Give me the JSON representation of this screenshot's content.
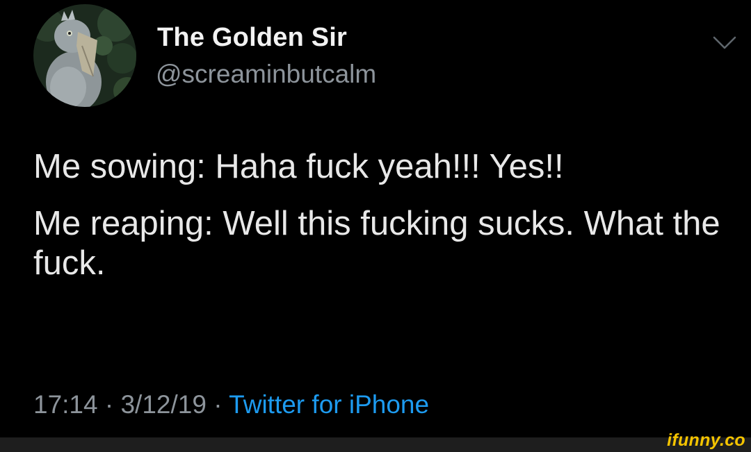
{
  "user": {
    "display_name": "The Golden Sir",
    "handle": "@screaminbutcalm",
    "avatar": "shoebill-bird-photo"
  },
  "menu_icon": "chevron-down-icon",
  "tweet": {
    "lines": [
      "Me sowing: Haha fuck yeah!!! Yes!!",
      "Me reaping: Well this fucking sucks. What the fuck."
    ]
  },
  "meta": {
    "time": "17:14",
    "separator": "·",
    "date": "3/12/19",
    "source": "Twitter for iPhone"
  },
  "watermark": "ifunny.co",
  "colors": {
    "background": "#000000",
    "text": "#e8e8e8",
    "secondary_text": "#8d949b",
    "link": "#1d9bf0",
    "watermark": "#f5c400"
  }
}
